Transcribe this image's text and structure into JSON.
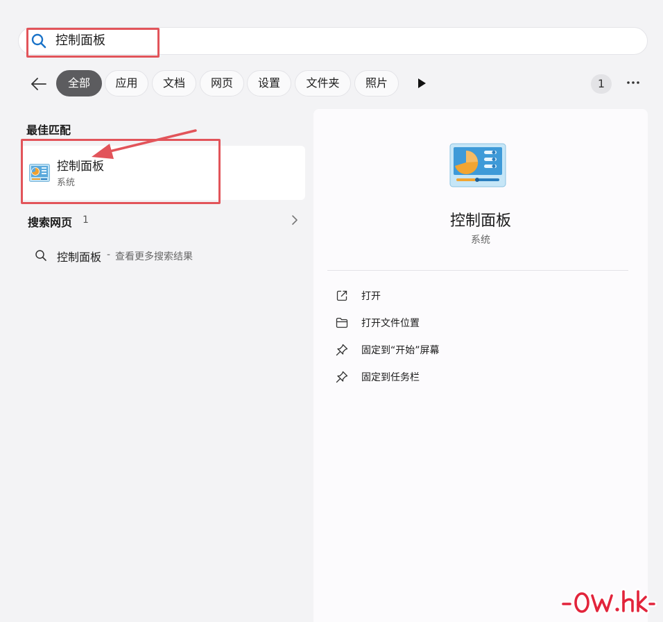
{
  "search": {
    "value": "控制面板"
  },
  "filters": {
    "back_icon": "arrow-left-icon",
    "chips": [
      {
        "label": "全部",
        "active": true
      },
      {
        "label": "应用"
      },
      {
        "label": "文档"
      },
      {
        "label": "网页"
      },
      {
        "label": "设置"
      },
      {
        "label": "文件夹"
      },
      {
        "label": "照片"
      }
    ],
    "more_icon": "play-icon",
    "count_badge": "1",
    "overflow_icon": "ellipsis-icon"
  },
  "results": {
    "best_match_title": "最佳匹配",
    "best_match": {
      "name": "控制面板",
      "type": "系统",
      "icon": "control-panel-icon"
    },
    "web_section_title": "搜索网页",
    "web_section_count": "1",
    "web_item": {
      "query": "控制面板",
      "separator": "-",
      "suffix": "查看更多搜索结果"
    }
  },
  "detail": {
    "name": "控制面板",
    "type": "系统",
    "actions": [
      {
        "label": "打开",
        "icon": "open-external-icon"
      },
      {
        "label": "打开文件位置",
        "icon": "folder-icon"
      },
      {
        "label": "固定到“开始”屏幕",
        "icon": "pin-icon"
      },
      {
        "label": "固定到任务栏",
        "icon": "pin-icon"
      }
    ]
  },
  "colors": {
    "annotation_red": "#e2545a",
    "chip_active": "#5c5c5f",
    "background": "#f3f3f5"
  },
  "watermark": {
    "text": "-Ow.hk-"
  }
}
